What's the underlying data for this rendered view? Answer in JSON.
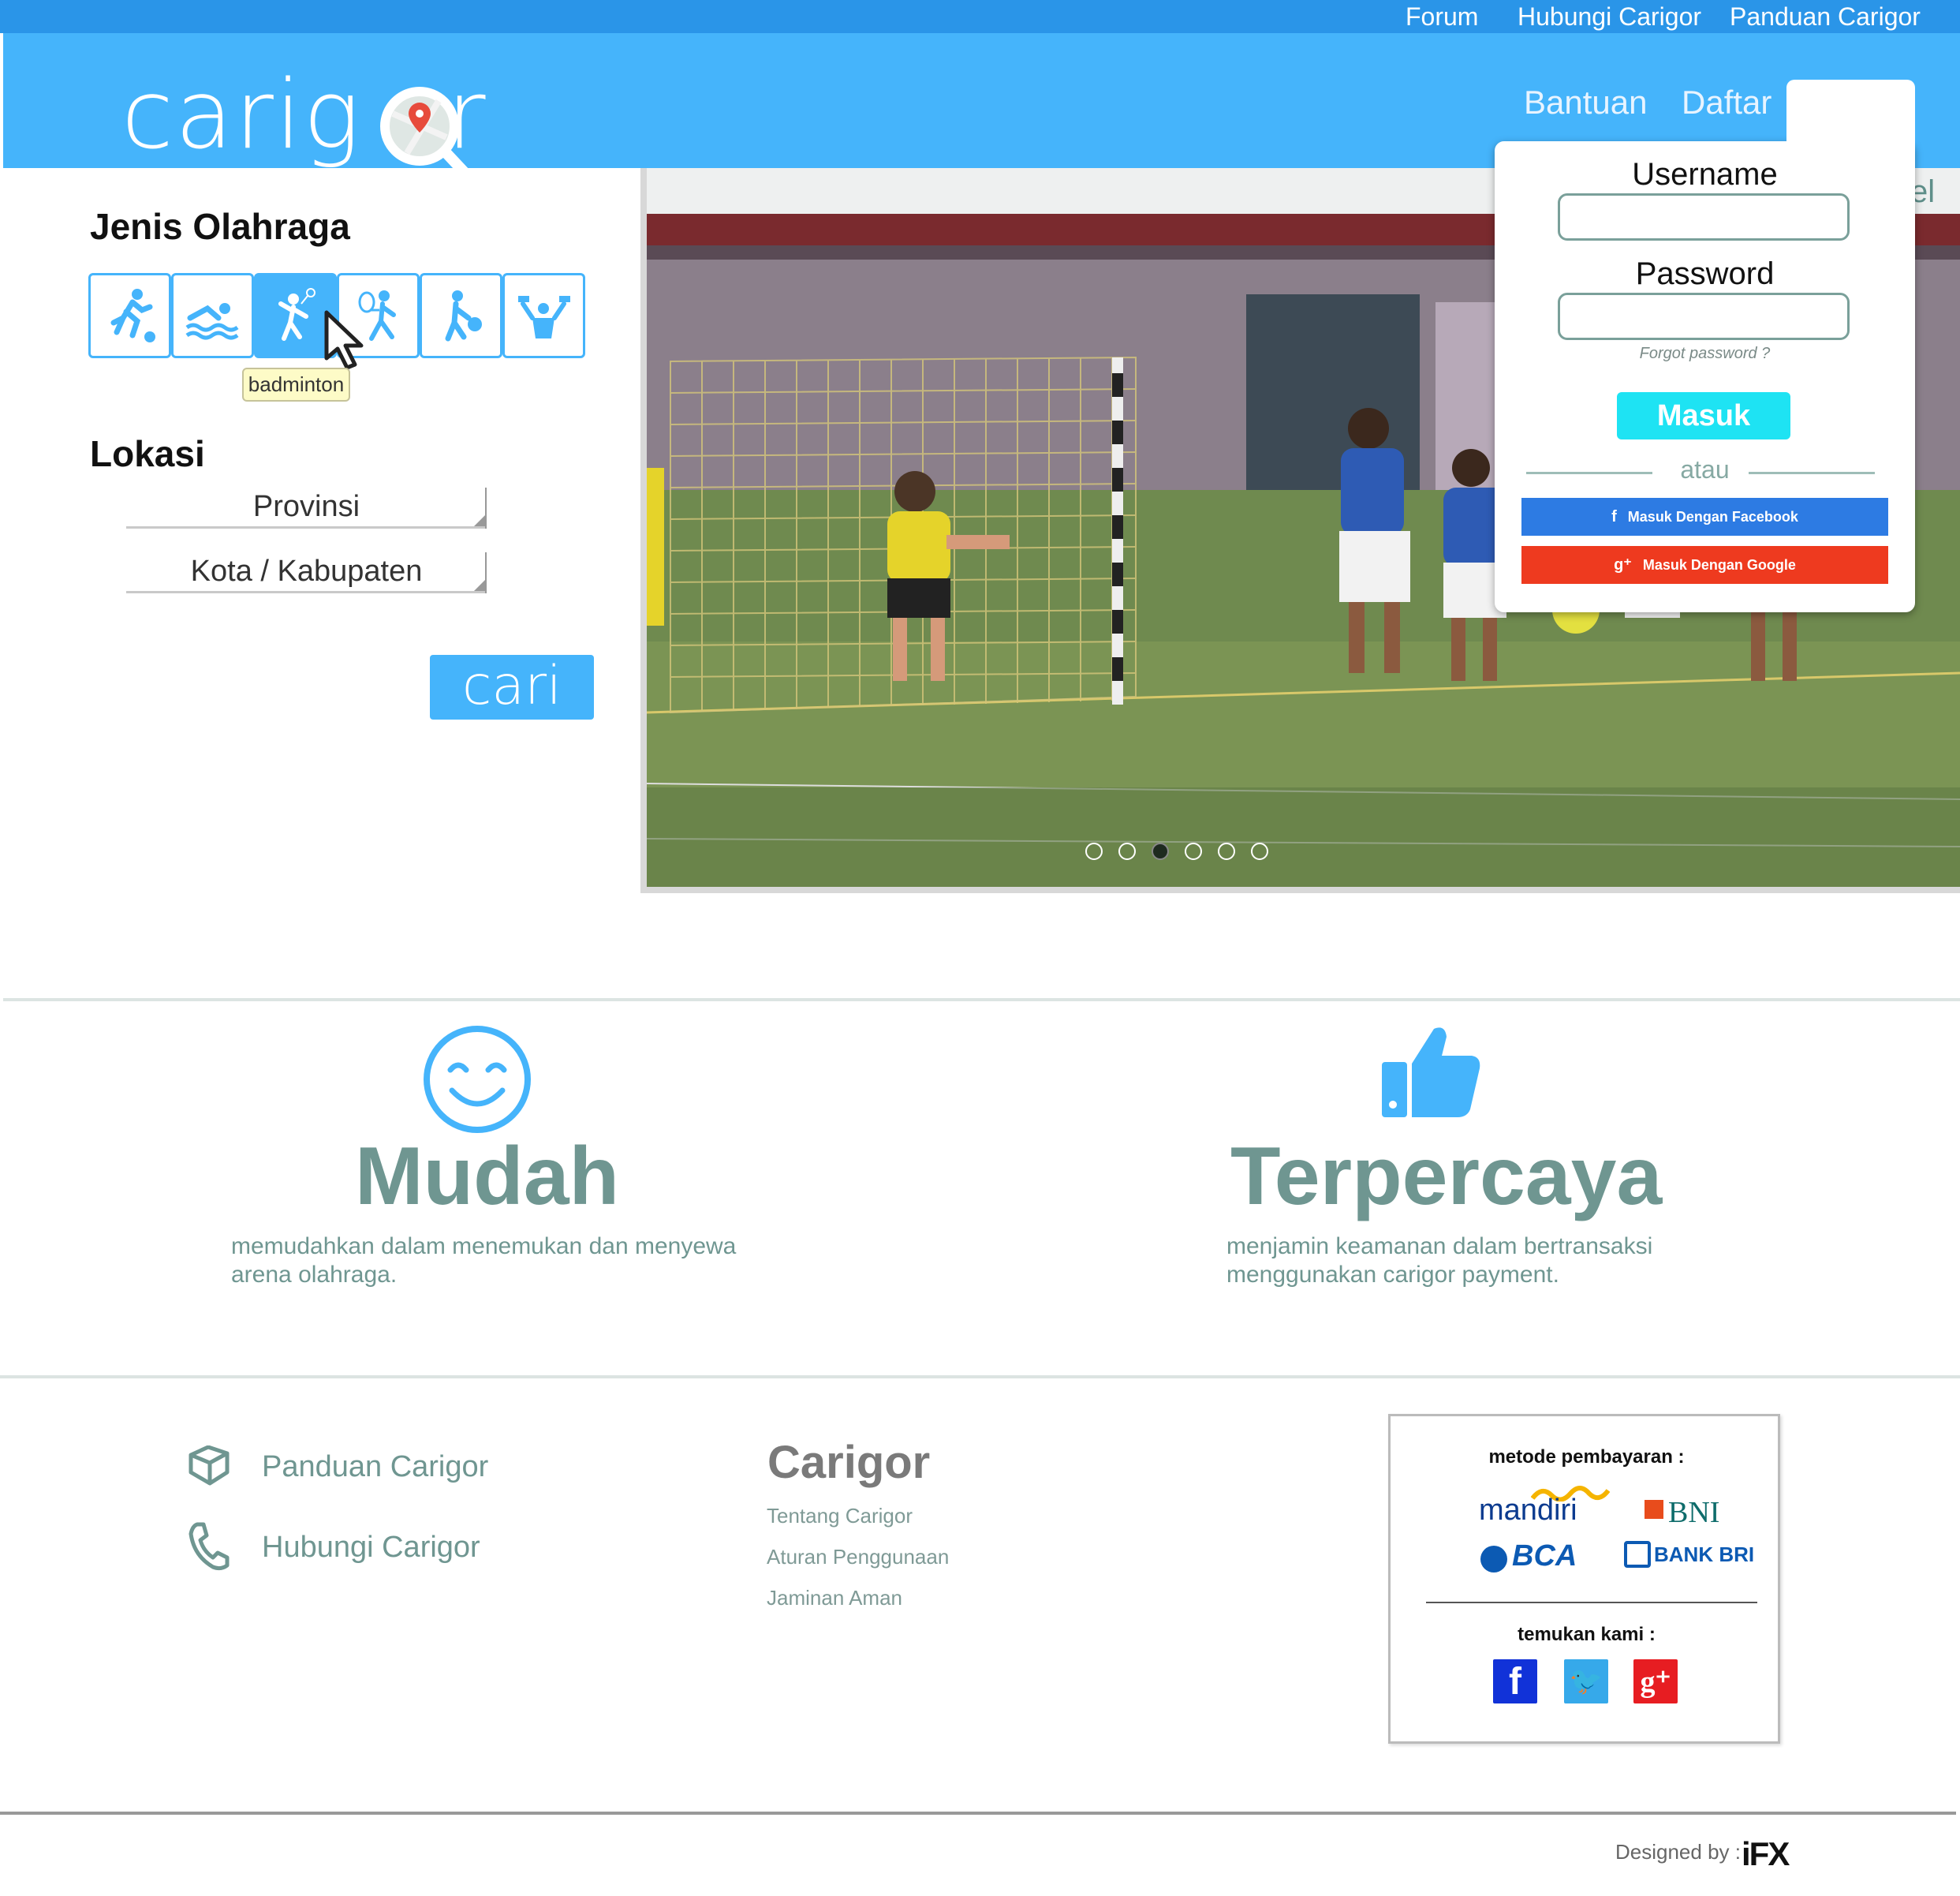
{
  "topbar": {
    "links": [
      "Forum",
      "Hubungi Carigor",
      "Panduan Carigor"
    ]
  },
  "header": {
    "logo_text": "carigor",
    "logo_prefix": "cari",
    "logo_g": "g",
    "logo_r": "r",
    "nav": [
      "Bantuan",
      "Daftar"
    ]
  },
  "search": {
    "sport_title": "Jenis Olahraga",
    "sports": [
      "running-icon",
      "swimming-icon",
      "badminton-icon",
      "tennis-icon",
      "basketball-icon",
      "fitness-icon"
    ],
    "tooltip": "badminton",
    "location_title": "Lokasi",
    "province": "Provinsi",
    "city": "Kota / Kabupaten",
    "button": "cari"
  },
  "slider": {
    "partial_text": "el",
    "slides": 6,
    "active": 3
  },
  "login": {
    "username_label": "Username",
    "password_label": "Password",
    "forgot": "Forgot password ?",
    "submit": "Masuk",
    "or": "atau",
    "facebook": "Masuk Dengan Facebook",
    "google": "Masuk Dengan Google"
  },
  "features": [
    {
      "title": "Mudah",
      "desc_line1": "memudahkan dalam menemukan dan menyewa",
      "desc_line2": "arena olahraga.",
      "icon": "smile-icon"
    },
    {
      "title": "Terpercaya",
      "desc_line1": "menjamin keamanan dalam bertransaksi",
      "desc_line2": "menggunakan carigor payment.",
      "icon": "thumbs-up-icon"
    }
  ],
  "footer": {
    "links": [
      "Panduan Carigor",
      "Hubungi Carigor"
    ],
    "carigor_title": "Carigor",
    "carigor_links": [
      "Tentang Carigor",
      "Aturan Penggunaan",
      "Jaminan Aman"
    ],
    "payment_title": "metode pembayaran :",
    "banks": [
      "mandiri",
      "BNI",
      "BCA",
      "BANK BRI"
    ],
    "find_title": "temukan kami :",
    "designed_by": "Designed by :",
    "designer": "iFX"
  },
  "colors": {
    "topbar": "#2a95e8",
    "header": "#45b4fb",
    "accent": "#45b4fb",
    "masuk": "#1ee3f3",
    "facebook": "#2d7be3",
    "google": "#ee3a1f",
    "feature_text": "#6f9691"
  }
}
